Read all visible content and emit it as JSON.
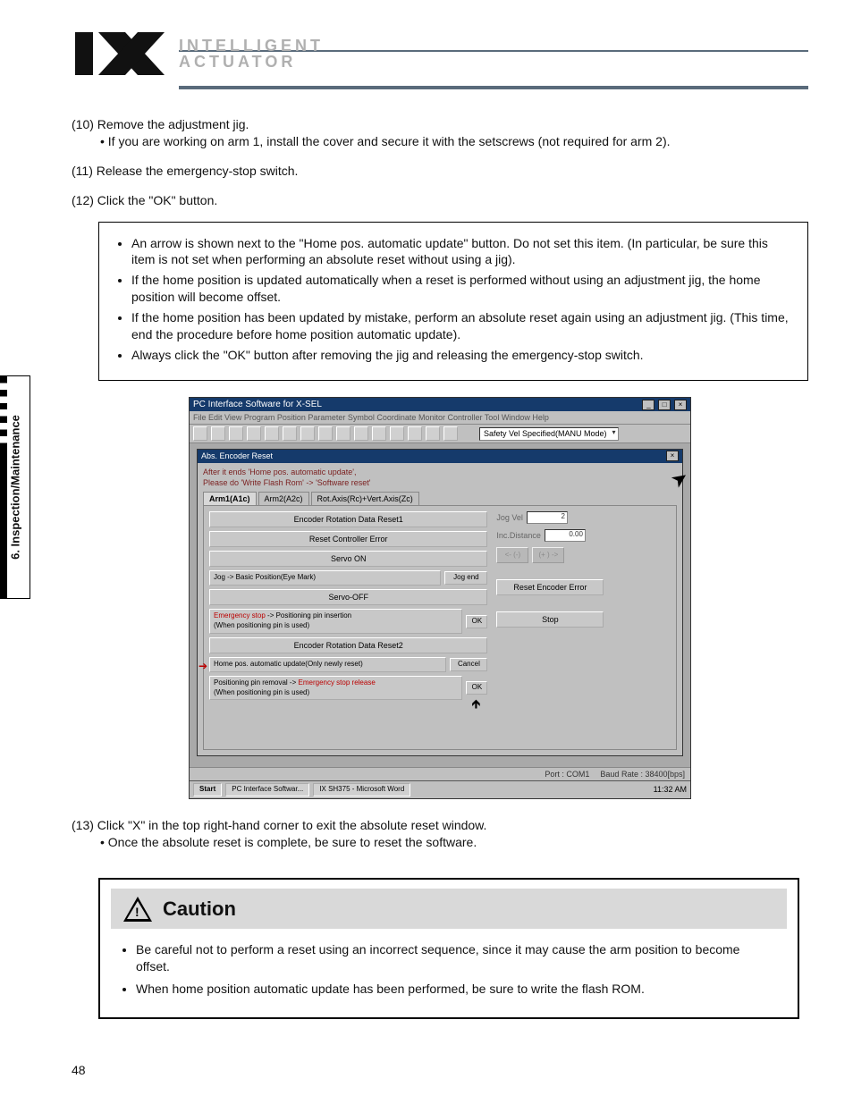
{
  "side_tab": "6. Inspection/Maintenance",
  "brand": {
    "line1": "INTELLIGENT",
    "line2": "ACTUATOR"
  },
  "steps": {
    "s10": {
      "num": "(10)",
      "text": "Remove the adjustment jig.",
      "sub": "If you are working on arm 1, install the cover and secure it with the setscrews (not required for arm 2)."
    },
    "s11": {
      "num": "(11)",
      "text": "Release the emergency-stop switch."
    },
    "s12": {
      "num": "(12)",
      "text": "Click the \"OK\" button."
    },
    "s13": {
      "num": "(13)",
      "text": "Click \"X\" in the top right-hand corner to exit the absolute reset window.",
      "sub": "Once the absolute reset is complete, be sure to reset the software."
    }
  },
  "note": {
    "b1": "An arrow is shown next to the \"Home pos. automatic update\" button. Do not set this item. (In particular, be sure this item is not set when performing an absolute reset without using a jig).",
    "b2": "If the home position is updated automatically when a reset is performed without using an adjustment jig, the home position will become offset.",
    "b3": "If the home position has been updated by mistake, perform an absolute reset again using an adjustment jig. (This time, end the procedure before home position automatic update).",
    "b4": "Always click the \"OK\" button after removing the jig and releasing the emergency-stop switch."
  },
  "screenshot": {
    "app_title": "PC Interface Software for X-SEL",
    "menubar": "File  Edit  View  Program  Position  Parameter  Symbol  Coordinate  Monitor  Controller  Tool  Window  Help",
    "combo": "Safety Vel Specified(MANU Mode)",
    "inner_title": "Abs. Encoder Reset",
    "hint_a": "After it ends 'Home pos. automatic update',",
    "hint_b": "Please do 'Write Flash Rom' -> 'Software reset'",
    "tabs": {
      "t1": "Arm1(A1c)",
      "t2": "Arm2(A2c)",
      "t3": "Rot.Axis(Rc)+Vert.Axis(Zc)"
    },
    "left": {
      "b1": "Encoder Rotation Data Reset1",
      "b2": "Reset Controller Error",
      "b3": "Servo ON",
      "b4_l": "Jog -> Basic Position(Eye Mark)",
      "b4_r": "Jog end",
      "b5": "Servo-OFF",
      "b6a": "Emergency stop",
      "b6b": " -> Positioning pin insertion",
      "b6c": "(When positioning pin is used)",
      "b7": "Encoder Rotation Data Reset2",
      "b8": "Home pos. automatic update(Only newly reset)",
      "b8cancel": "Cancel",
      "b9a": "Positioning pin removal -> ",
      "b9b": "Emergency stop release",
      "b9c": "(When positioning pin is used)"
    },
    "right": {
      "jogvel": "Jog Vel",
      "jogvel_val": "2",
      "incdist": "Inc.Distance",
      "incdist_val": "0.00",
      "neg": "<- (-)",
      "pos": "(+ ) ->",
      "reset_err": "Reset Encoder Error",
      "stop": "Stop"
    },
    "ok": "OK",
    "status": {
      "port": "Port : COM1",
      "baud": "Baud Rate : 38400[bps]"
    },
    "taskbar": {
      "start": "Start",
      "task1": "PC Interface Softwar...",
      "task2": "IX SH375 - Microsoft Word",
      "time": "11:32 AM"
    }
  },
  "caution": {
    "title": "Caution",
    "c1": "Be careful not to perform a reset using an incorrect sequence, since it may cause the arm position to become offset.",
    "c2": "When home position automatic update has been performed, be sure to write the flash ROM."
  },
  "page_number": "48"
}
